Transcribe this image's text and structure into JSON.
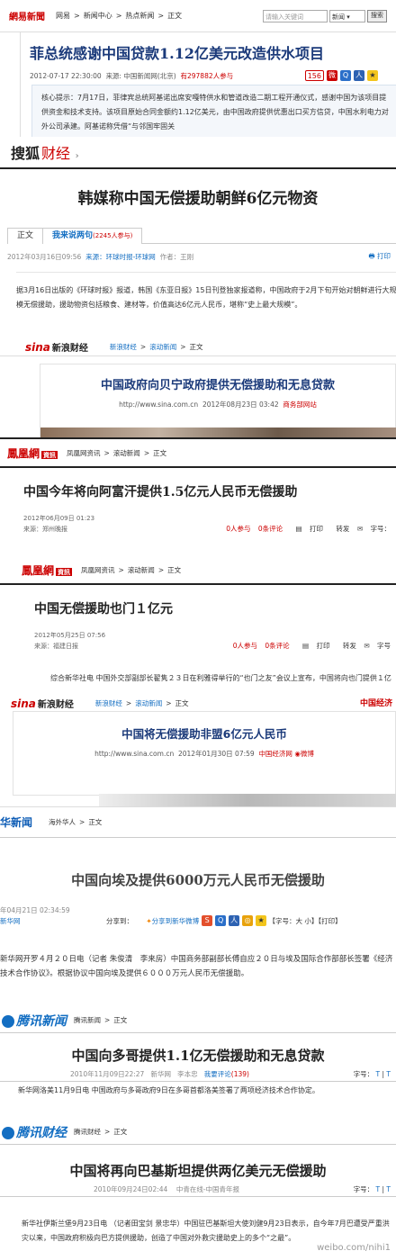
{
  "p1": {
    "logo": "網易新聞",
    "crumbs": [
      "网易",
      ">",
      "新闻中心",
      ">",
      "热点新闻",
      ">",
      "正文"
    ],
    "search_placeholder": "请输入关键词",
    "search_select": "新闻",
    "search_go": "搜索",
    "title": "菲总统感谢中国贷款1.12亿美元改造供水项目",
    "date": "2012-07-17 22:30:00",
    "source": "来源: 中国新闻网(北京)",
    "participants": "有297882人参与",
    "comment_count": "156",
    "summary": "核心提示：7月17日，菲律宾总统阿基诺出席安嘎特供水和管道改造二期工程开通仪式，感谢中国为该项目提供资金和技术支持。该项目原始合同金额约1.12亿美元，由中国政府提供优惠出口买方信贷，中国水利电力对外公司承建。阿基诺称凭借“与邻国牢固关"
  },
  "p2": {
    "logo": "搜狐",
    "logo_sub": "财经",
    "title": "韩媒称中国无偿援助朝鲜6亿元物资",
    "tab1": "正文",
    "tab2": "我来说两句",
    "tab2_count": "(2245人参与)",
    "date": "2012年03月16日09:56",
    "source": "来源：环球时报-环球网",
    "author": "作者：王刚",
    "print": "打印",
    "body": "据3月16日出版的《环球时报》报道，韩国《东亚日报》15日刊登独家报道称，中国政府于2月下旬开始对朝鲜进行大规模无偿援助，援助物资包括粮食、建材等，价值高达6亿元人民币，堪称“史上最大规模”。"
  },
  "p3": {
    "logo": "sina",
    "logo_sub": "新浪财经",
    "crumbs": [
      "新浪财经",
      ">",
      "滚动新闻",
      ">",
      "正文"
    ],
    "title": "中国政府向贝宁政府提供无偿援助和无息贷款",
    "url": "http://www.sina.com.cn",
    "date": "2012年08月23日 03:42",
    "source": "商务部网站"
  },
  "p4": {
    "logo": "鳳凰網",
    "logo_tag": "資訊",
    "crumbs": [
      "凤凰网资讯",
      ">",
      "滚动新闻",
      ">",
      "正文"
    ],
    "title": "中国今年将向阿富汗提供1.5亿元人民币无偿援助",
    "date": "2012年06月09日 01:23",
    "source": "来源：郑州晚报",
    "actions": [
      "0人参与",
      "0条评论",
      "打印",
      "转发",
      "字号："
    ]
  },
  "p5": {
    "logo": "鳳凰網",
    "logo_tag": "資訊",
    "crumbs": [
      "凤凰网资讯",
      ">",
      "滚动新闻",
      ">",
      "正文"
    ],
    "title": "中国无偿援助也门１亿元",
    "date": "2012年05月25日 07:56",
    "source": "来源：福建日报",
    "actions": [
      "0人参与",
      "0条评论",
      "打印",
      "转发",
      "字号"
    ],
    "body": "综合新华社电 中国外交部副部长翟隽２３日在利雅得举行的“也门之友”会议上宣布，中国将向也门提供１亿元人民币无偿援助。"
  },
  "p6": {
    "logo": "sina",
    "logo_sub": "新浪财经",
    "crumbs": [
      "新浪财经",
      ">",
      "滚动新闻",
      ">",
      "正文"
    ],
    "corner": "中国经济",
    "title": "中国将无偿援助非盟6亿元人民币",
    "url": "http://www.sina.com.cn",
    "date": "2012年01月30日 07:59",
    "source": "中国经济网",
    "weibo": "微博"
  },
  "p7": {
    "logo": "华新闻",
    "crumbs": [
      "海外华人",
      ">",
      "正文"
    ],
    "title": "中国向埃及提供6000万元人民币无偿援助",
    "date": "年04月21日 02:34:59",
    "source": "新华网",
    "share_label": "分享到：",
    "share_weibo": "分享到新华微博",
    "font_size": "【字号：大 小】【打印】",
    "body": "新华网开罗４月２０日电（记者 朱俊清　李来房）中国商务部副部长傅自应２０日与埃及国际合作部部长签署《经济技术合作协议》。根据协议中国向埃及提供６０００万元人民币无偿援助。"
  },
  "p8": {
    "logo": "腾讯新闻",
    "crumbs": [
      "腾讯新闻",
      ">",
      "正文"
    ],
    "title": "中国向多哥提供1.1亿无偿援助和无息贷款",
    "date": "2010年11月09日22:27",
    "source": "新华网",
    "author": "李本忠",
    "comment": "我要评论",
    "comment_count": "(139)",
    "font_size": "字号：",
    "body": "新华网洛美11月9日电 中国政府与多哥政府9日在多哥首都洛美签署了两项经济技术合作协定。"
  },
  "p9": {
    "logo": "腾讯财经",
    "crumbs": [
      "腾讯财经",
      ">",
      "正文"
    ],
    "title": "中国将再向巴基斯坦提供两亿美元无偿援助",
    "date": "2010年09月24日02:44",
    "source": "中青在线-中国青年报",
    "font_size": "字号：",
    "body": "新华社伊斯兰堡9月23日电 （记者田宝剑 景忠华）中国驻巴基斯坦大使刘健9月23日表示，自今年7月巴遭受严重洪灾以来，中国政府积极向巴方提供援助，创造了中国对外救灾援助史上的多个“之最”。",
    "watermark": "weibo.com/nihi1"
  },
  "colors": {
    "netease_red": "#c00000",
    "sina_red": "#cc0000",
    "link_blue": "#136ec2",
    "title_navy": "#1b3a7a"
  }
}
